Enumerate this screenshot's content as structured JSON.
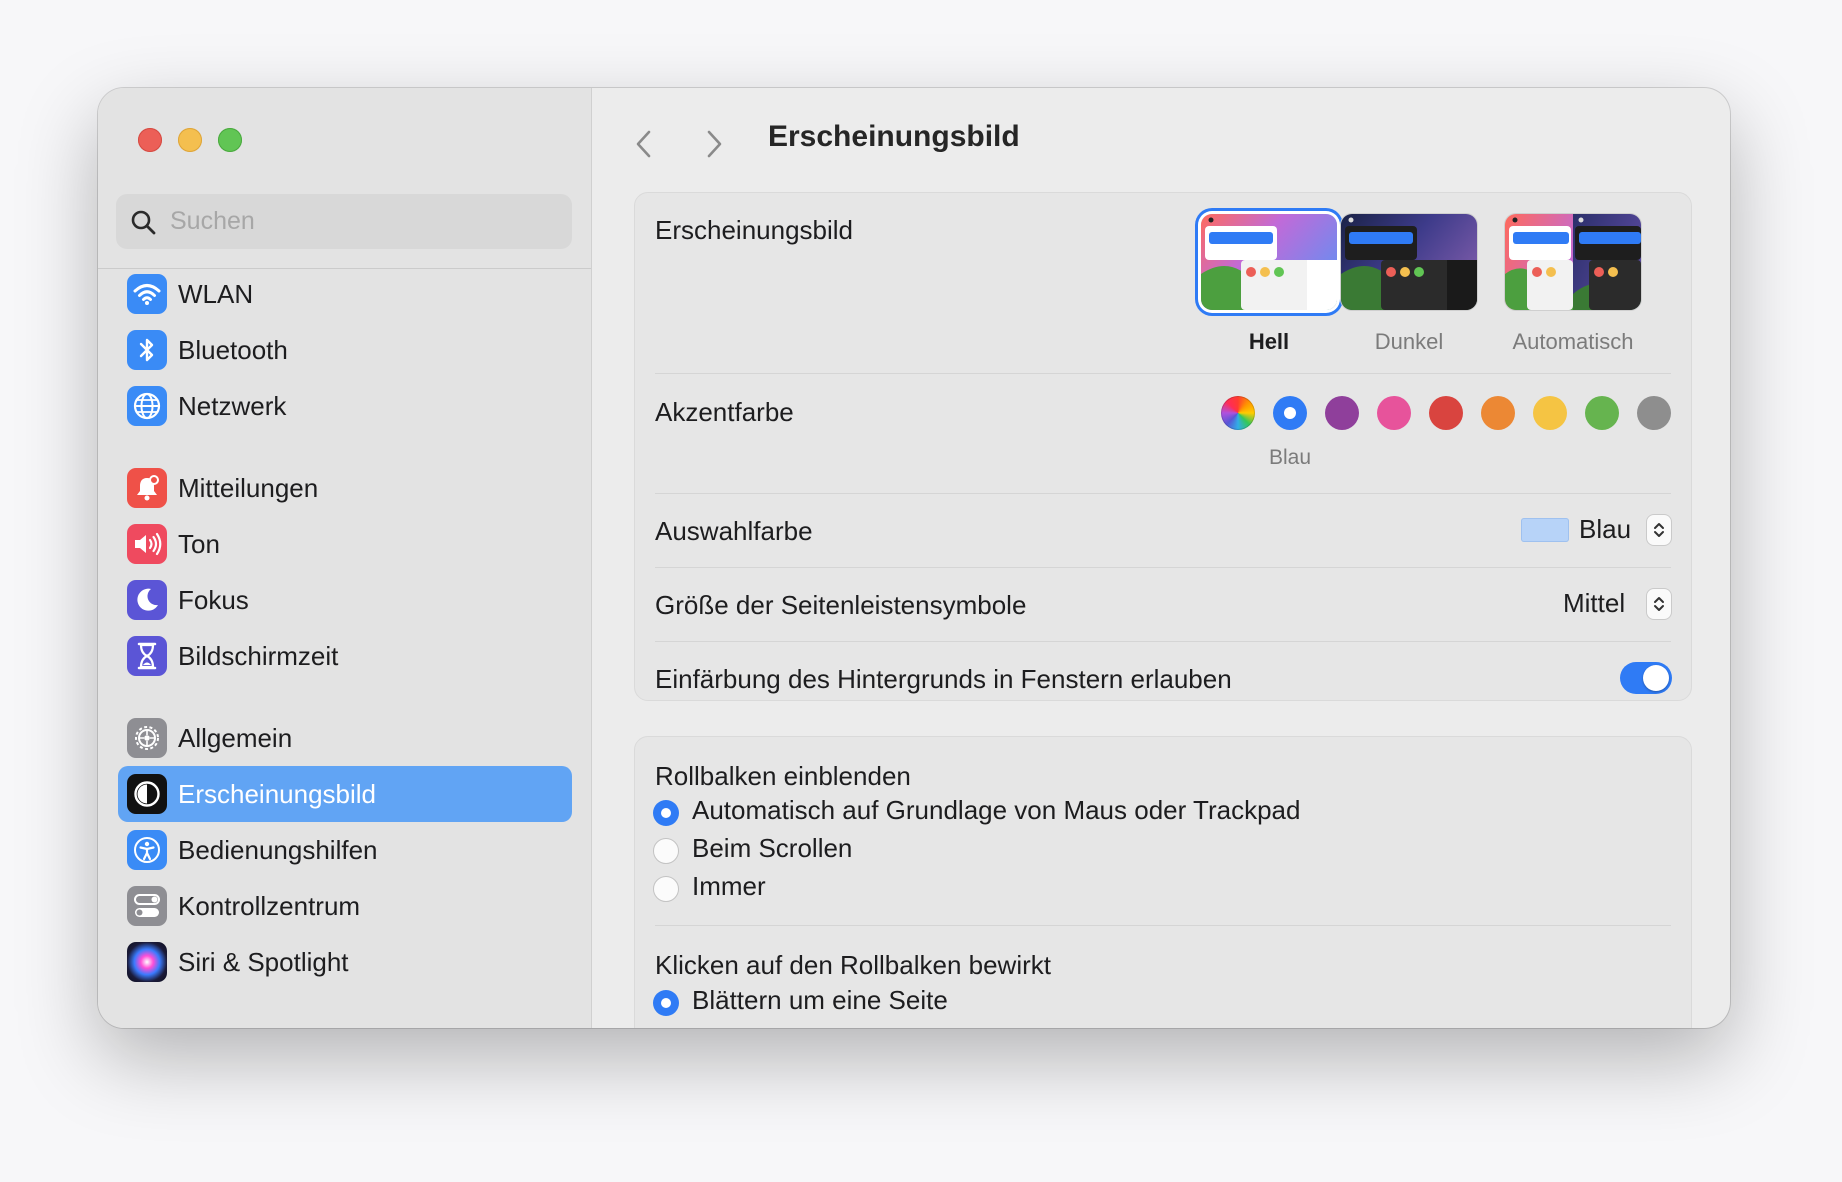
{
  "window": {
    "title": "Erscheinungsbild"
  },
  "search": {
    "placeholder": "Suchen",
    "icon": "magnifier"
  },
  "sidebar": {
    "items": [
      {
        "label": "WLAN",
        "icon": "wifi-icon",
        "color": "#3a8bf6"
      },
      {
        "label": "Bluetooth",
        "icon": "bluetooth-icon",
        "color": "#3a8bf6"
      },
      {
        "label": "Netzwerk",
        "icon": "globe-icon",
        "color": "#3a8bf6"
      },
      {
        "label": "Mitteilungen",
        "icon": "bell-icon",
        "color": "#ef5148"
      },
      {
        "label": "Ton",
        "icon": "speaker-icon",
        "color": "#ef4a5f"
      },
      {
        "label": "Fokus",
        "icon": "moon-icon",
        "color": "#5b55d6"
      },
      {
        "label": "Bildschirmzeit",
        "icon": "hourglass-icon",
        "color": "#5b55d6"
      },
      {
        "label": "Allgemein",
        "icon": "gear-icon",
        "color": "#8e8e93"
      },
      {
        "label": "Erscheinungsbild",
        "icon": "appearance-icon",
        "color": "#111111",
        "selected": true
      },
      {
        "label": "Bedienungshilfen",
        "icon": "accessibility-icon",
        "color": "#3a8bf6"
      },
      {
        "label": "Kontrollzentrum",
        "icon": "toggles-icon",
        "color": "#8e8e93"
      },
      {
        "label": "Siri & Spotlight",
        "icon": "siri-icon",
        "color": "#222244"
      }
    ]
  },
  "appearance": {
    "label": "Erscheinungsbild",
    "options": [
      {
        "label": "Hell",
        "selected": true
      },
      {
        "label": "Dunkel",
        "selected": false
      },
      {
        "label": "Automatisch",
        "selected": false
      }
    ]
  },
  "accent": {
    "label": "Akzentfarbe",
    "selected_name": "Blau",
    "colors": [
      {
        "name": "multicolor",
        "hex": "multicolor"
      },
      {
        "name": "Blau",
        "hex": "#2f7bf5",
        "selected": true
      },
      {
        "name": "purple",
        "hex": "#8f3f9b"
      },
      {
        "name": "pink",
        "hex": "#e7539b"
      },
      {
        "name": "red",
        "hex": "#d9443f"
      },
      {
        "name": "orange",
        "hex": "#ec8834"
      },
      {
        "name": "yellow",
        "hex": "#f5c443"
      },
      {
        "name": "green",
        "hex": "#66b44f"
      },
      {
        "name": "graphite",
        "hex": "#8e8e8e"
      }
    ]
  },
  "highlight": {
    "label": "Auswahlfarbe",
    "value": "Blau",
    "swatch": "#b7d3f8"
  },
  "sidebar_icon_size": {
    "label": "Größe der Seitenleistensymbole",
    "value": "Mittel"
  },
  "wallpaper_tinting": {
    "label": "Einfärbung des Hintergrunds in Fenstern erlauben",
    "enabled": true
  },
  "scrollbars": {
    "label": "Rollbalken einblenden",
    "options": [
      {
        "label": "Automatisch auf Grundlage von Maus oder Trackpad",
        "selected": true
      },
      {
        "label": "Beim Scrollen",
        "selected": false
      },
      {
        "label": "Immer",
        "selected": false
      }
    ]
  },
  "click_scrollbar": {
    "label": "Klicken auf den Rollbalken bewirkt",
    "options": [
      {
        "label": "Blättern um eine Seite",
        "selected": true
      }
    ]
  },
  "colors": {
    "accent": "#2f7bf5",
    "sidebar_selection": "#61a4f4"
  }
}
